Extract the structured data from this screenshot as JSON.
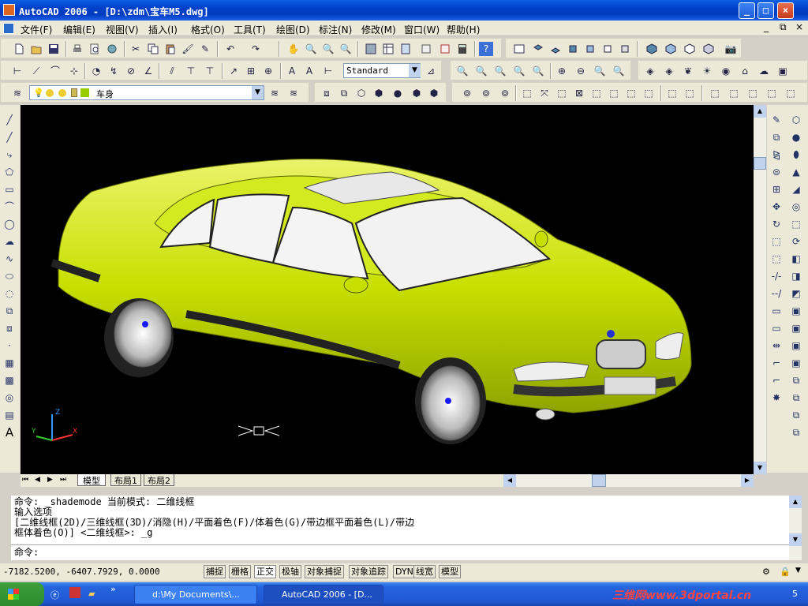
{
  "window": {
    "title": "AutoCAD 2006 - [D:\\zdm\\宝车M5.dwg]",
    "min": "_",
    "max": "□",
    "close": "×",
    "doc_min": "_",
    "doc_restore": "⧉",
    "doc_close": "×"
  },
  "menu": [
    "文件(F)",
    "编辑(E)",
    "视图(V)",
    "插入(I)",
    "格式(O)",
    "工具(T)",
    "绘图(D)",
    "标注(N)",
    "修改(M)",
    "窗口(W)",
    "帮助(H)"
  ],
  "toolbar": {
    "text_style": "Standard",
    "layer": "车身"
  },
  "tabs": [
    "模型",
    "布局1",
    "布局2"
  ],
  "ucs": {
    "x": "X",
    "y": "Y",
    "z": "Z"
  },
  "command": {
    "lines": [
      "命令: _shademode 当前模式: 二维线框",
      "输入选项",
      "[二维线框(2D)/三维线框(3D)/消隐(H)/平面着色(F)/体着色(G)/带边框平面着色(L)/带边",
      "框体着色(O)] <二维线框>: _g"
    ],
    "prompt": "命令:"
  },
  "status": {
    "coords": "-7182.5200, -6407.7929, 0.0000",
    "buttons": [
      "捕捉",
      "栅格",
      "正交",
      "极轴",
      "对象捕捉",
      "对象追踪",
      "DYN",
      "线宽",
      "模型"
    ]
  },
  "taskbar": {
    "start": "开始",
    "tasks": [
      "d:\\My Documents\\...",
      "AutoCAD 2006 - [D..."
    ],
    "watermark": "三维网www.3dportal.cn",
    "time": "5"
  },
  "colors": {
    "title": "#0040c8",
    "car": "#c8e000",
    "canvas": "#000000"
  }
}
